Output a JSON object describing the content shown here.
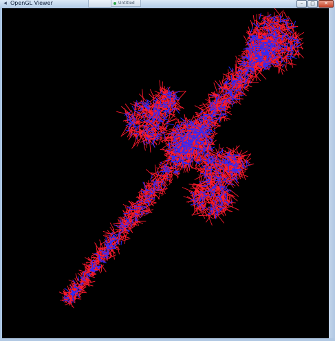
{
  "window": {
    "title": "OpenGL Viewer",
    "app_icon": "app-icon",
    "background_tab_label": "Untitled",
    "controls": {
      "minimize": "–",
      "maximize": "□",
      "close": "✕"
    }
  },
  "viewport": {
    "background_color": "#000000",
    "fiber_color": "#ff1a2e",
    "core_color": "#2a2aff"
  }
}
